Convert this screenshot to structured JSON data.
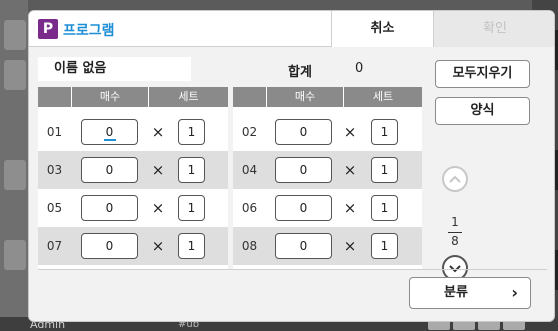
{
  "background": {
    "user_label": "Admin",
    "status_text": "#ub"
  },
  "dialog": {
    "app_icon_letter": "P",
    "title": "프로그램",
    "cancel_label": "취소",
    "ok_label": "확인",
    "name_value": "이름 없음",
    "total_label": "합계",
    "total_value": "0",
    "clear_all_label": "모두지우기",
    "form_label": "양식",
    "classify_label": "분류",
    "classify_chevron": "›",
    "times_symbol": "×",
    "page": {
      "current": "1",
      "total": "8"
    },
    "columns": {
      "left": {
        "sheets": "매수",
        "sets": "세트"
      },
      "right": {
        "sheets": "매수",
        "sets": "세트"
      }
    },
    "rows": [
      {
        "left": {
          "no": "01",
          "sheets": "0",
          "sets": "1"
        },
        "right": {
          "no": "02",
          "sheets": "0",
          "sets": "1"
        }
      },
      {
        "left": {
          "no": "03",
          "sheets": "0",
          "sets": "1"
        },
        "right": {
          "no": "04",
          "sheets": "0",
          "sets": "1"
        }
      },
      {
        "left": {
          "no": "05",
          "sheets": "0",
          "sets": "1"
        },
        "right": {
          "no": "06",
          "sheets": "0",
          "sets": "1"
        }
      },
      {
        "left": {
          "no": "07",
          "sheets": "0",
          "sets": "1"
        },
        "right": {
          "no": "08",
          "sheets": "0",
          "sets": "1"
        }
      }
    ],
    "icons": {
      "up": "chevron-up-icon",
      "down": "chevron-down-icon",
      "app": "program-p-icon"
    },
    "colors": {
      "accent": "#1e8ed6",
      "app_icon": "#7a2a8a"
    }
  }
}
